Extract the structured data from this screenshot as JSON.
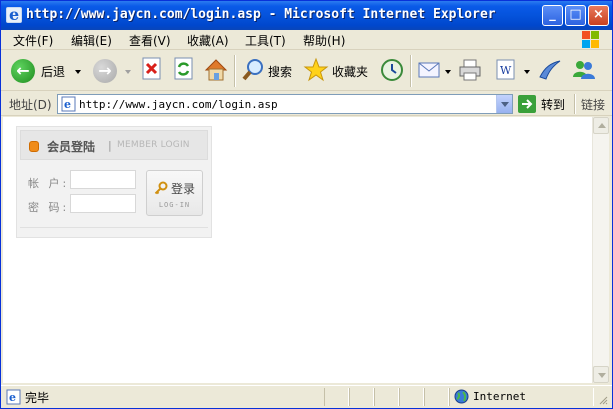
{
  "window": {
    "title": "http://www.jaycn.com/login.asp - Microsoft Internet Explorer",
    "minimize_glyph": "_",
    "maximize_glyph": "□",
    "close_glyph": "×"
  },
  "menubar": {
    "items": [
      "文件(F)",
      "编辑(E)",
      "查看(V)",
      "收藏(A)",
      "工具(T)",
      "帮助(H)"
    ]
  },
  "toolbar": {
    "back_label": "后退",
    "search_label": "搜索",
    "favorites_label": "收藏夹",
    "icons": [
      "back-icon",
      "forward-icon",
      "stop-icon",
      "refresh-icon",
      "home-icon",
      "search-icon",
      "favorites-icon",
      "history-icon",
      "mail-icon",
      "print-icon",
      "word-icon",
      "messenger-icon",
      "msn-icon"
    ]
  },
  "addressbar": {
    "label": "地址(D)",
    "url": "http://www.jaycn.com/login.asp",
    "go_label": "转到",
    "links_label": "链接"
  },
  "login": {
    "title": "会员登陆",
    "divider": "|",
    "subtitle": "MEMBER LOGIN",
    "account_label": "帐 户:",
    "password_label": "密 码:",
    "account_value": "",
    "password_value": "",
    "button_label": "登录",
    "button_sub": "LOG-IN"
  },
  "statusbar": {
    "text": "完毕",
    "zone": "Internet"
  },
  "colors": {
    "titlebar": "#0553dc",
    "chrome": "#ece9d8",
    "accent_orange": "#f08c1a"
  }
}
